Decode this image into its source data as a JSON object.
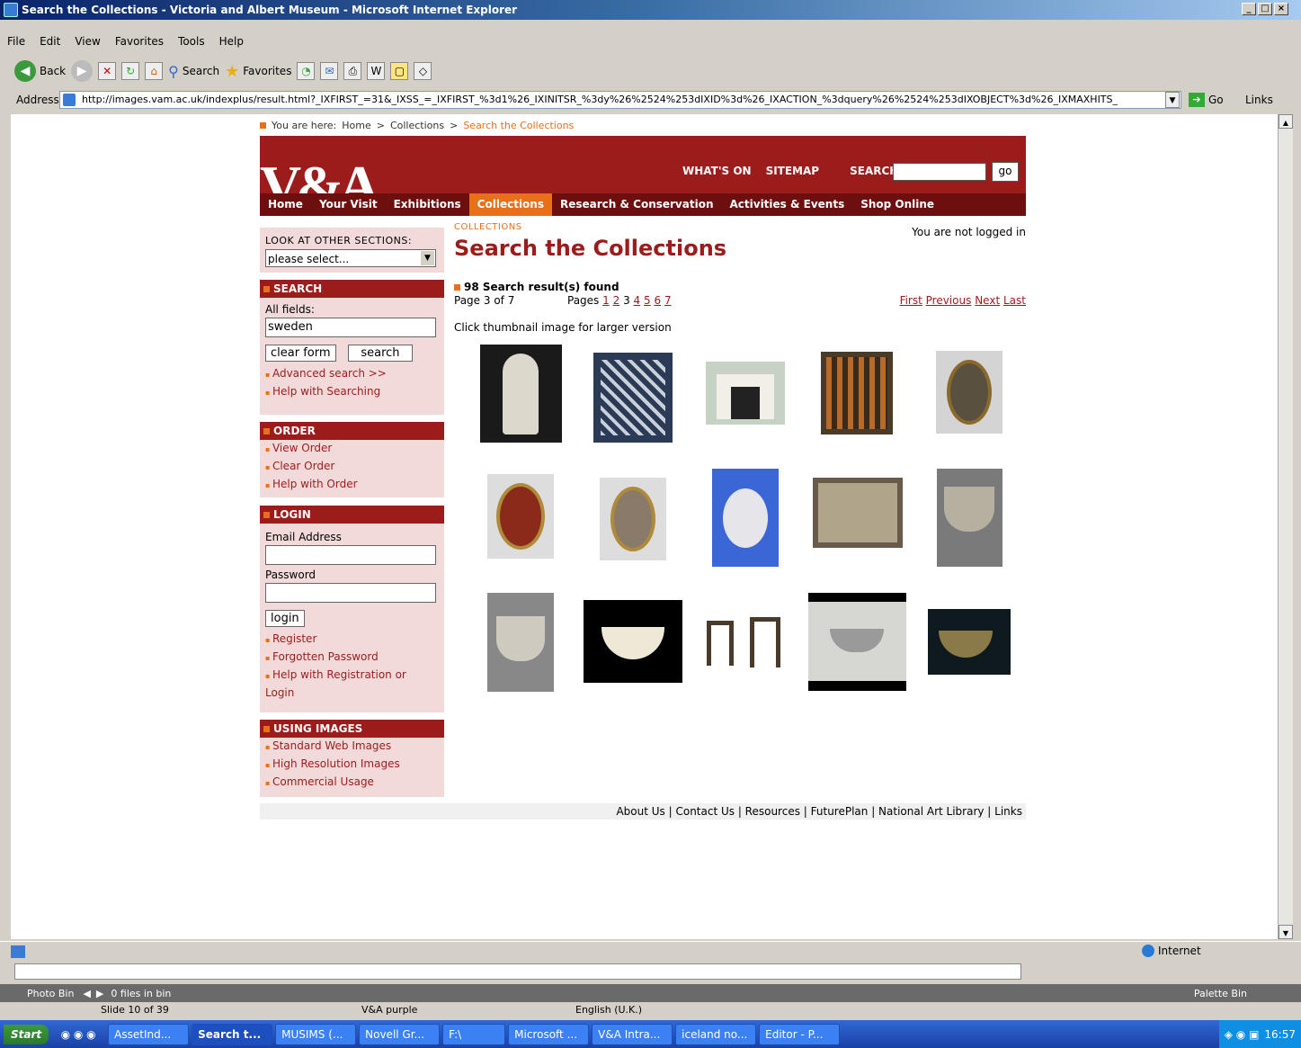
{
  "window": {
    "title": "Search the Collections - Victoria and Albert Museum - Microsoft Internet Explorer",
    "menu": [
      "File",
      "Edit",
      "View",
      "Favorites",
      "Tools",
      "Help"
    ],
    "toolbar": {
      "back": "Back",
      "search": "Search",
      "favorites": "Favorites"
    },
    "address_label": "Address",
    "url": "http://images.vam.ac.uk/indexplus/result.html?_IXFIRST_=31&_IXSS_=_IXFIRST_%3d1%26_IXINITSR_%3dy%26%2524%253dIXID%3d%26_IXACTION_%3dquery%26%2524%253dIXOBJECT%3d%26_IXMAXHITS_",
    "go": "Go",
    "links": "Links",
    "status_zone": "Internet"
  },
  "page": {
    "breadcrumb": {
      "prefix": "You are here:",
      "home": "Home",
      "sep1": ">",
      "collections": "Collections",
      "sep2": ">",
      "current": "Search the Collections"
    },
    "logo": "V&A",
    "topnav": {
      "whats_on": "WHAT'S ON",
      "sitemap": "SITEMAP",
      "search_label": "SEARCH:",
      "go": "go"
    },
    "mainnav": [
      "Home",
      "Your Visit",
      "Exhibitions",
      "Collections",
      "Research & Conservation",
      "Activities & Events",
      "Shop Online"
    ],
    "sidebar": {
      "other_label": "LOOK AT OTHER SECTIONS:",
      "other_select": "please select...",
      "search_head": "SEARCH",
      "all_fields": "All fields:",
      "query": "sweden",
      "clear": "clear form",
      "search": "search",
      "advanced": "Advanced search >>",
      "help_search": "Help with Searching",
      "order_head": "ORDER",
      "view_order": "View Order",
      "clear_order": "Clear Order",
      "help_order": "Help with Order",
      "login_head": "LOGIN",
      "email": "Email Address",
      "password": "Password",
      "login": "login",
      "register": "Register",
      "forgot": "Forgotten Password",
      "help_reg": "Help with Registration or Login",
      "images_head": "USING IMAGES",
      "std": "Standard Web Images",
      "hires": "High Resolution Images",
      "commercial": "Commercial Usage"
    },
    "main": {
      "section": "COLLECTIONS",
      "title": "Search the Collections",
      "logged": "You are not logged in",
      "found": "98 Search result(s) found",
      "pageof": "Page 3 of 7",
      "pages_label": "Pages",
      "pages": [
        "1",
        "2",
        "3",
        "4",
        "5",
        "6",
        "7"
      ],
      "first": "First",
      "previous": "Previous",
      "next": "Next",
      "last": "Last",
      "hint": "Click thumbnail image for larger version"
    },
    "footer": "About Us | Contact Us | Resources | FuturePlan | National Art Library | Links"
  },
  "powerpoint": {
    "photo_bin": "Photo Bin",
    "files": "0 files in bin",
    "palette": "Palette Bin",
    "slide": "Slide 10 of 39",
    "theme": "V&A purple",
    "lang": "English (U.K.)"
  },
  "taskbar": {
    "start": "Start",
    "tasks": [
      "AssetInd...",
      "Search t...",
      "MUSIMS (...",
      "Novell Gr...",
      "F:\\",
      "Microsoft ...",
      "V&A Intra...",
      "iceland no...",
      "Editor - P..."
    ],
    "clock": "16:57"
  }
}
